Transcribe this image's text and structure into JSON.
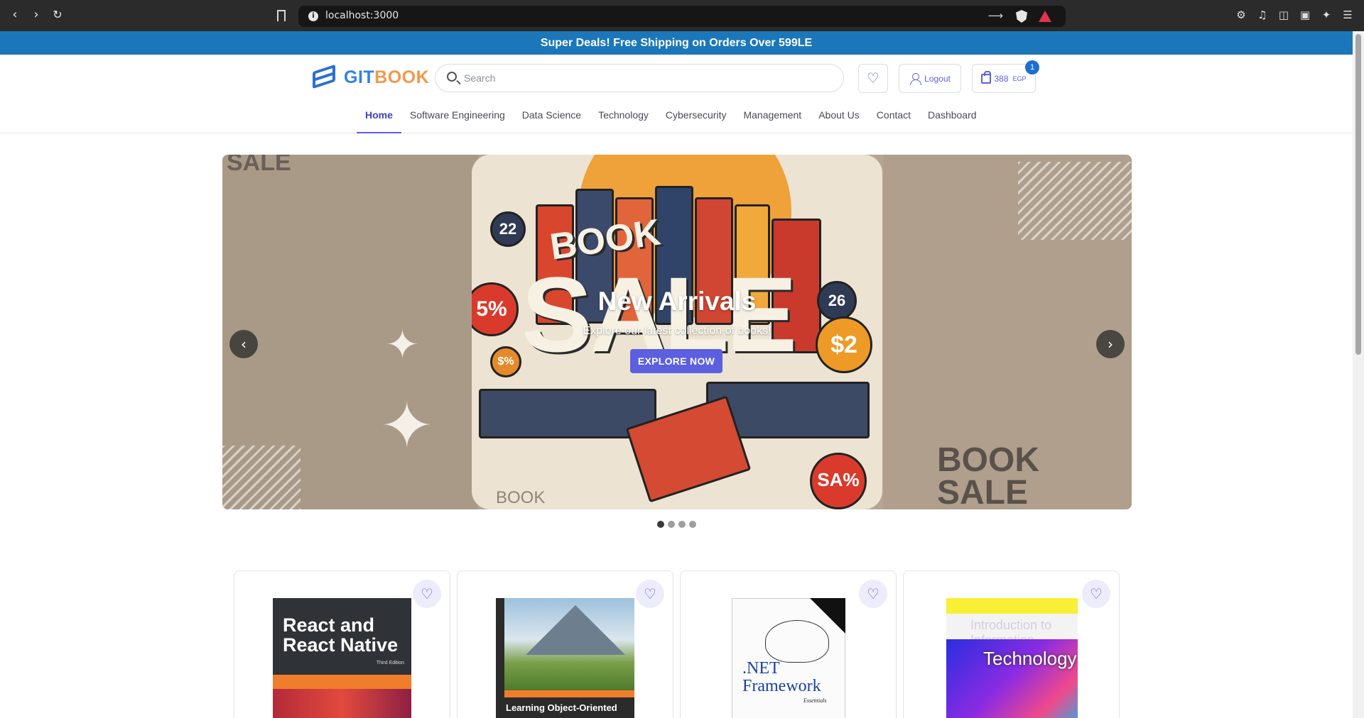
{
  "browser": {
    "url": "localhost:3000"
  },
  "promo": {
    "text": "Super Deals! Free Shipping on Orders Over 599LE"
  },
  "header": {
    "logo_text_a": "GIT",
    "logo_text_b": "BOOK",
    "search_placeholder": "Search",
    "logout_label": "Logout",
    "cart_amount": "388",
    "cart_currency": "EGP",
    "cart_count": "1"
  },
  "nav": {
    "items": [
      {
        "label": "Home",
        "active": true
      },
      {
        "label": "Software Engineering"
      },
      {
        "label": "Data Science"
      },
      {
        "label": "Technology"
      },
      {
        "label": "Cybersecurity"
      },
      {
        "label": "Management"
      },
      {
        "label": "About Us"
      },
      {
        "label": "Contact"
      },
      {
        "label": "Dashboard"
      }
    ]
  },
  "hero": {
    "title": "New Arrivals",
    "subtitle": "Explore our latest collection of books!",
    "cta": "EXPLORE NOW",
    "image_text": {
      "sale_top_left": "SALE",
      "book": "BOOK",
      "sale": "SALE",
      "book_sale_right_line1": "BOOK",
      "book_sale_right_line2": "SALE",
      "coin_1": "22",
      "coin_2": "5%",
      "coin_3": "$2",
      "coin_4": "26",
      "coin_5": "SA%",
      "coin_6": "$%"
    },
    "slide_count": 4,
    "active_slide": 1
  },
  "products": [
    {
      "cover_title": "React and React Native",
      "cover_edition": "Third Edition"
    },
    {
      "cover_title": "Learning Object-Oriented"
    },
    {
      "cover_title": ".NET Framework",
      "cover_subtitle": "Essentials"
    },
    {
      "cover_title_faint": "Introduction to Information",
      "cover_title": "Technology"
    }
  ],
  "colors": {
    "promo_bg": "#1b77b9",
    "accent": "#5b5fe0",
    "logo_blue": "#2f80ed",
    "logo_orange": "#f2994a"
  },
  "icons": {
    "wishlist": "heart-icon",
    "user": "user-icon",
    "cart": "shopping-bag-icon",
    "search": "search-icon"
  }
}
